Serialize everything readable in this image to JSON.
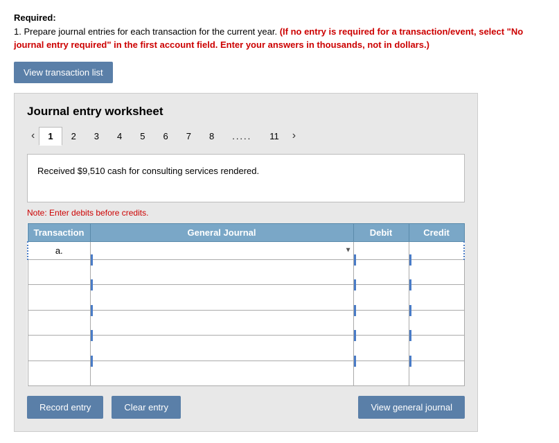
{
  "required": {
    "heading": "Required:",
    "instruction_normal": "1. Prepare journal entries for each transaction for the current year. ",
    "instruction_bold": "(If no entry is required for a transaction/event, select \"No journal entry required\" in the first account field. Enter your answers in thousands, not in dollars.)"
  },
  "view_transaction_btn": "View transaction list",
  "worksheet": {
    "title": "Journal entry worksheet",
    "tabs": [
      "1",
      "2",
      "3",
      "4",
      "5",
      "6",
      "7",
      "8",
      "11"
    ],
    "dots": ".....",
    "description": "Received $9,510 cash for consulting services rendered.",
    "note": "Note: Enter debits before credits.",
    "table": {
      "headers": [
        "Transaction",
        "General Journal",
        "Debit",
        "Credit"
      ],
      "rows": [
        {
          "transaction": "a.",
          "general_journal": "",
          "debit": "",
          "credit": ""
        },
        {
          "transaction": "",
          "general_journal": "",
          "debit": "",
          "credit": ""
        },
        {
          "transaction": "",
          "general_journal": "",
          "debit": "",
          "credit": ""
        },
        {
          "transaction": "",
          "general_journal": "",
          "debit": "",
          "credit": ""
        },
        {
          "transaction": "",
          "general_journal": "",
          "debit": "",
          "credit": ""
        },
        {
          "transaction": "",
          "general_journal": "",
          "debit": "",
          "credit": ""
        }
      ]
    },
    "buttons": {
      "record_entry": "Record entry",
      "clear_entry": "Clear entry",
      "view_general_journal": "View general journal"
    }
  }
}
